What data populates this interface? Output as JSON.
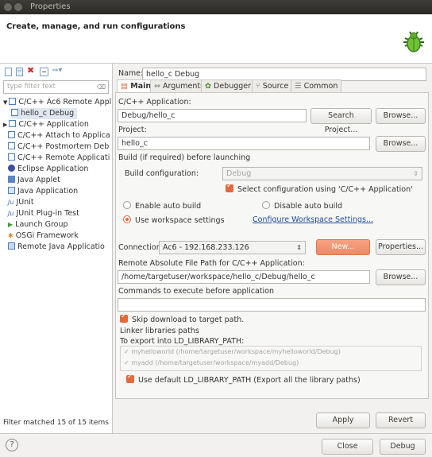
{
  "window": {
    "title": "Properties"
  },
  "header": {
    "title": "Create, manage, and run configurations"
  },
  "sidebar": {
    "filter_placeholder": "type filter text",
    "tree": [
      {
        "label": "C/C++ Ac6 Remote Appl",
        "icon": "c-config-icon",
        "expanded": true
      },
      {
        "label": "hello_c Debug",
        "icon": "c-config-icon",
        "selected": true
      },
      {
        "label": "C/C++ Application",
        "icon": "c-config-icon",
        "expanded": false
      },
      {
        "label": "C/C++ Attach to Applica",
        "icon": "c-config-icon"
      },
      {
        "label": "C/C++ Postmortem Deb",
        "icon": "c-config-icon"
      },
      {
        "label": "C/C++ Remote Applicati",
        "icon": "c-config-icon"
      },
      {
        "label": "Eclipse Application",
        "icon": "eclipse-icon"
      },
      {
        "label": "Java Applet",
        "icon": "applet-icon"
      },
      {
        "label": "Java Application",
        "icon": "java-icon"
      },
      {
        "label": "JUnit",
        "icon": "junit-icon"
      },
      {
        "label": "JUnit Plug-in Test",
        "icon": "junit-plugin-icon"
      },
      {
        "label": "Launch Group",
        "icon": "launch-group-icon"
      },
      {
        "label": "OSGi Framework",
        "icon": "osgi-icon"
      },
      {
        "label": "Remote Java Applicatio",
        "icon": "remote-java-icon"
      }
    ],
    "status": "Filter matched 15 of 15 items"
  },
  "main": {
    "name_label": "Name:",
    "name_value": "hello_c Debug",
    "tabs": [
      "Main",
      "Arguments",
      "Debugger",
      "Source",
      "Common"
    ],
    "c_app_label": "C/C++ Application:",
    "c_app_value": "Debug/hello_c",
    "search_project": "Search Project...",
    "browse": "Browse...",
    "project_label": "Project:",
    "project_value": "hello_c",
    "build_label": "Build (if required) before launching",
    "build_config_label": "Build configuration:",
    "build_config_value": "Debug",
    "select_config_label": "Select configuration using 'C/C++ Application'",
    "enable_auto_build": "Enable auto build",
    "disable_auto_build": "Disable auto build",
    "use_workspace": "Use workspace settings",
    "configure_workspace": "Configure Workspace Settings...",
    "connection_label": "Connection:",
    "connection_value": "Ac6 - 192.168.233.126",
    "new_btn": "New...",
    "properties_btn": "Properties...",
    "remote_path_label": "Remote Absolute File Path for C/C++ Application:",
    "remote_path_value": "/home/targetuser/workspace/hello_c/Debug/hello_c",
    "commands_label": "Commands to execute before application",
    "skip_download": "Skip download to target path.",
    "linker_label": "Linker libraries paths",
    "ld_label": "To export into LD_LIBRARY_PATH:",
    "ld_paths": [
      "myhelloworld (/home/targetuser/workspace/myhelloworld/Debug)",
      "myadd (/home/targetuser/workspace/myadd/Debug)"
    ],
    "use_default_ld": "Use default LD_LIBRARY_PATH (Export all the library paths)",
    "apply": "Apply",
    "revert": "Revert"
  },
  "footer": {
    "help_icon": "?",
    "close": "Close",
    "debug": "Debug"
  }
}
